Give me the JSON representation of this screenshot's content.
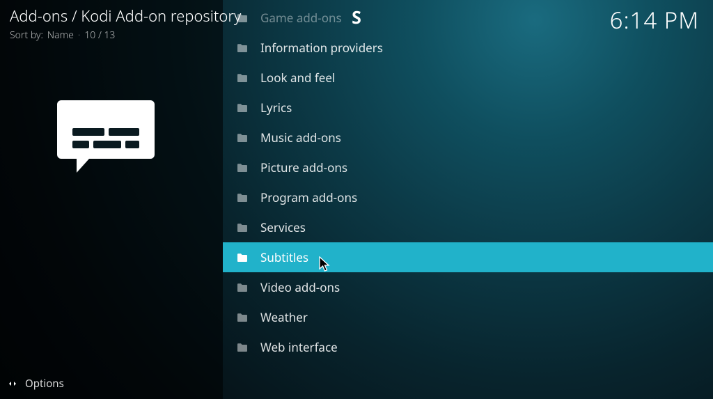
{
  "header": {
    "breadcrumb": "Add-ons / Kodi Add-on repository",
    "sort_prefix": "Sort by:",
    "sort_value": "Name",
    "position": "10 / 13",
    "clock": "6:14 PM",
    "section_letter": "S"
  },
  "options_label": "Options",
  "selected_index": 8,
  "rows": [
    {
      "label": "Game add-ons"
    },
    {
      "label": "Information providers"
    },
    {
      "label": "Look and feel"
    },
    {
      "label": "Lyrics"
    },
    {
      "label": "Music add-ons"
    },
    {
      "label": "Picture add-ons"
    },
    {
      "label": "Program add-ons"
    },
    {
      "label": "Services"
    },
    {
      "label": "Subtitles"
    },
    {
      "label": "Video add-ons"
    },
    {
      "label": "Weather"
    },
    {
      "label": "Web interface"
    }
  ]
}
